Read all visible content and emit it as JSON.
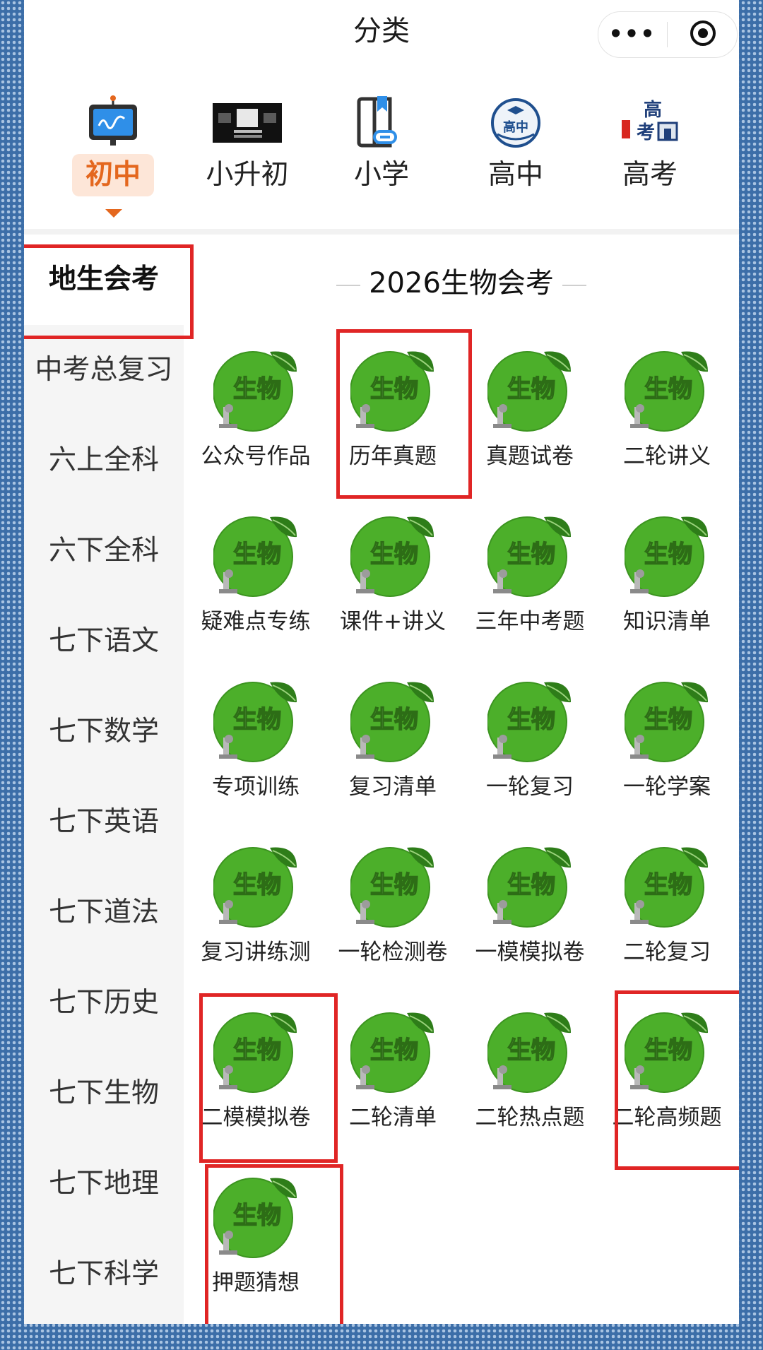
{
  "header": {
    "title": "分类"
  },
  "top_categories": [
    {
      "label": "初中",
      "icon": "whiteboard-icon",
      "active": true
    },
    {
      "label": "小升初",
      "icon": "banner-thumbnail-icon",
      "active": false
    },
    {
      "label": "小学",
      "icon": "book-link-icon",
      "active": false
    },
    {
      "label": "高中",
      "icon": "graduation-cap-badge-icon",
      "active": false
    },
    {
      "label": "高考",
      "icon": "gaokao-gate-icon",
      "active": false
    }
  ],
  "sidebar": {
    "items": [
      {
        "label": "地生会考",
        "active": true
      },
      {
        "label": "中考总复习"
      },
      {
        "label": "六上全科"
      },
      {
        "label": "六下全科"
      },
      {
        "label": "七下语文"
      },
      {
        "label": "七下数学"
      },
      {
        "label": "七下英语"
      },
      {
        "label": "七下道法"
      },
      {
        "label": "七下历史"
      },
      {
        "label": "七下生物"
      },
      {
        "label": "七下地理"
      },
      {
        "label": "七下科学"
      }
    ]
  },
  "section": {
    "title": "2026生物会考",
    "thumb_text": "生物",
    "items": [
      {
        "label": "公众号作品"
      },
      {
        "label": "历年真题"
      },
      {
        "label": "真题试卷"
      },
      {
        "label": "二轮讲义"
      },
      {
        "label": "疑难点专练"
      },
      {
        "label": "课件+讲义"
      },
      {
        "label": "三年中考题"
      },
      {
        "label": "知识清单"
      },
      {
        "label": "专项训练"
      },
      {
        "label": "复习清单"
      },
      {
        "label": "一轮复习"
      },
      {
        "label": "一轮学案"
      },
      {
        "label": "复习讲练测"
      },
      {
        "label": "一轮检测卷"
      },
      {
        "label": "一模模拟卷"
      },
      {
        "label": "二轮复习"
      },
      {
        "label": "二模模拟卷"
      },
      {
        "label": "二轮清单"
      },
      {
        "label": "二轮热点题"
      },
      {
        "label": "二轮高频题"
      },
      {
        "label": "押题猜想"
      }
    ]
  },
  "colors": {
    "accent": "#e4671e",
    "highlight": "#e02525",
    "thumb_green": "#4caf2a"
  }
}
